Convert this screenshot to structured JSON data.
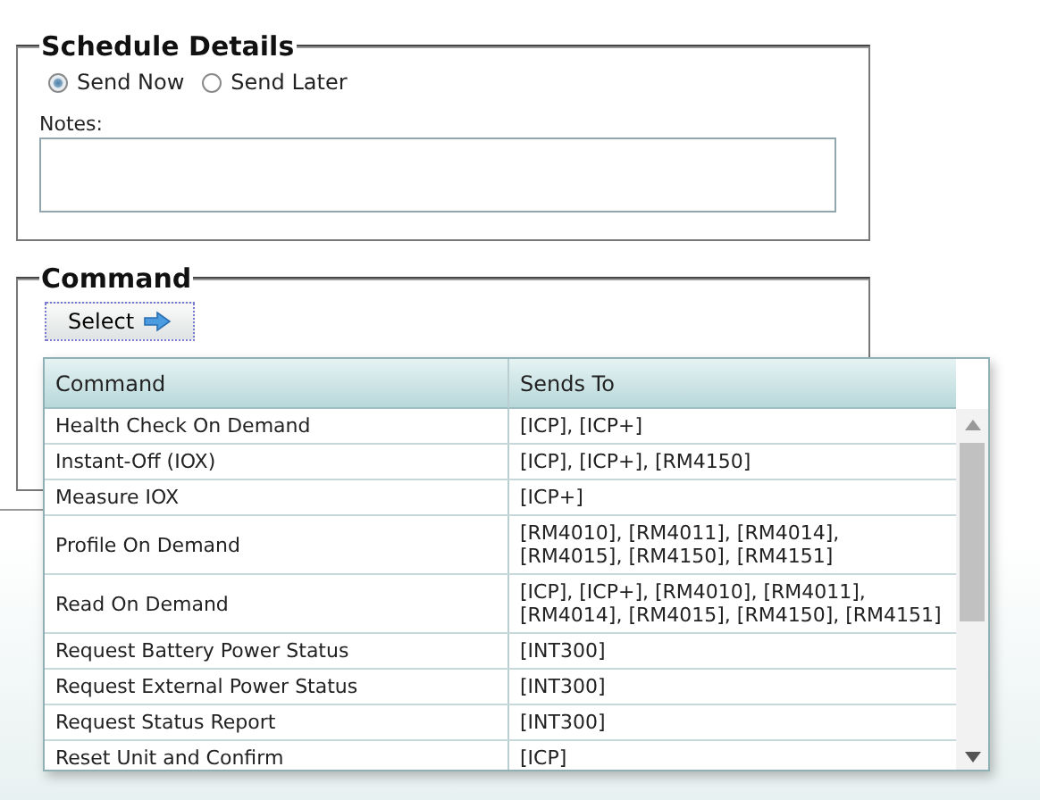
{
  "schedule": {
    "title": "Schedule Details",
    "options": [
      {
        "label": "Send Now",
        "selected": true
      },
      {
        "label": "Send Later",
        "selected": false
      }
    ],
    "notes_label": "Notes:"
  },
  "command": {
    "title": "Command",
    "select_button": "Select"
  },
  "popup": {
    "columns": [
      "Command",
      "Sends To"
    ],
    "rows": [
      {
        "command": "Health Check On Demand",
        "sends_to": "[ICP], [ICP+]"
      },
      {
        "command": "Instant-Off (IOX)",
        "sends_to": "[ICP], [ICP+], [RM4150]"
      },
      {
        "command": "Measure IOX",
        "sends_to": "[ICP+]"
      },
      {
        "command": "Profile On Demand",
        "sends_to": "[RM4010], [RM4011], [RM4014], [RM4015], [RM4150], [RM4151]"
      },
      {
        "command": "Read On Demand",
        "sends_to": "[ICP], [ICP+], [RM4010], [RM4011], [RM4014], [RM4015], [RM4150], [RM4151]"
      },
      {
        "command": "Request Battery Power Status",
        "sends_to": "[INT300]"
      },
      {
        "command": "Request External Power Status",
        "sends_to": "[INT300]"
      },
      {
        "command": "Request Status Report",
        "sends_to": "[INT300]"
      },
      {
        "command": "Reset Unit and Confirm",
        "sends_to": "[ICP]"
      }
    ]
  }
}
